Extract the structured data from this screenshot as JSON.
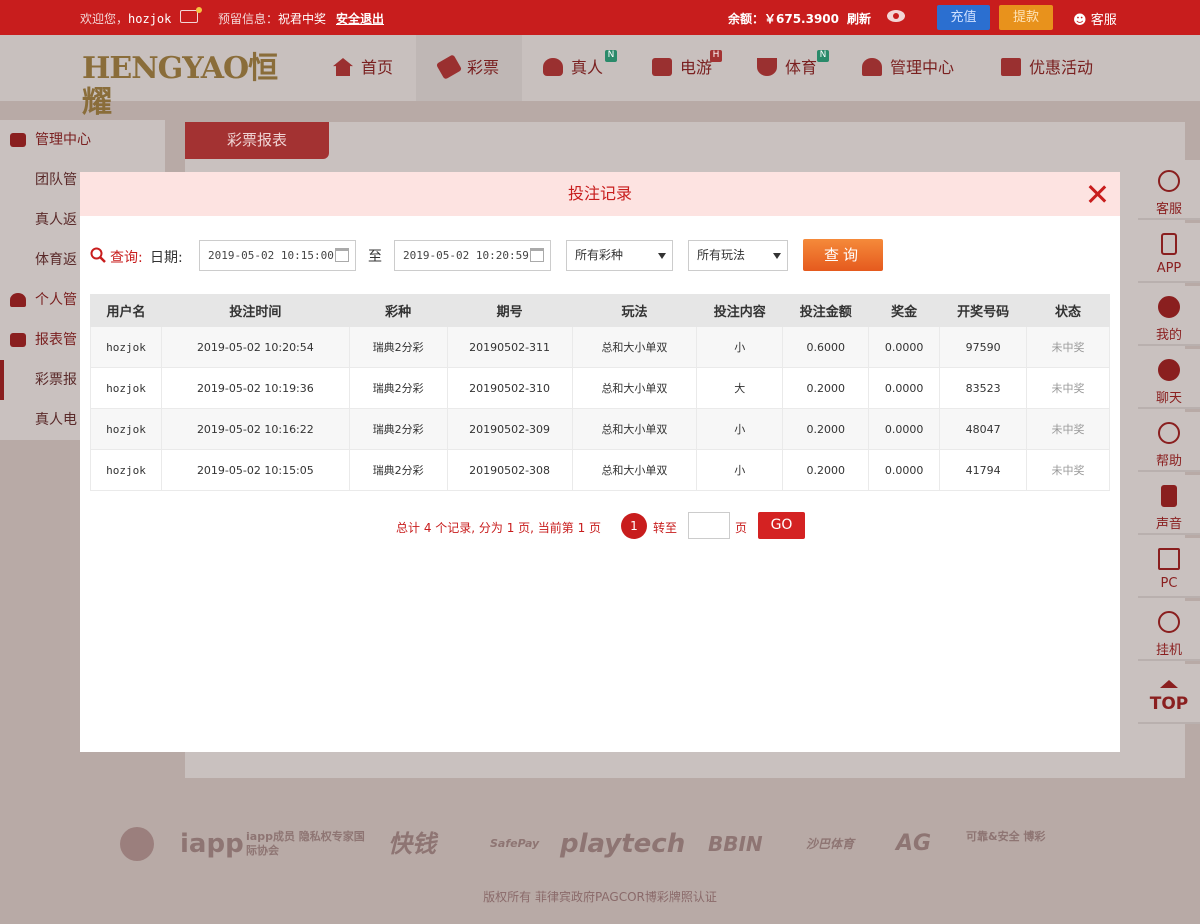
{
  "topbar": {
    "welcome_prefix": "欢迎您，",
    "username": "hozjok",
    "notice_label": "预留信息：",
    "notice_text": "祝君中奖",
    "logout": "安全退出",
    "balance": "余额：￥675.3900",
    "refresh": "刷新",
    "recharge": "充值",
    "withdraw": "提款",
    "customer_service": "客服"
  },
  "nav": {
    "logo": "HENGYAO恒耀",
    "items": [
      {
        "label": "首页",
        "badge": ""
      },
      {
        "label": "彩票",
        "badge": ""
      },
      {
        "label": "真人",
        "badge": "N"
      },
      {
        "label": "电游",
        "badge": "H"
      },
      {
        "label": "体育",
        "badge": "N"
      },
      {
        "label": "管理中心",
        "badge": ""
      },
      {
        "label": "优惠活动",
        "badge": ""
      }
    ]
  },
  "sidebar": {
    "items": [
      "管理中心",
      "团队管",
      "真人返",
      "体育返",
      "个人管",
      "报表管",
      "彩票报",
      "真人电"
    ]
  },
  "content": {
    "tab": "彩票报表"
  },
  "right_bar": [
    "客服",
    "APP",
    "我的",
    "聊天",
    "帮助",
    "声音",
    "PC",
    "挂机",
    "TOP"
  ],
  "modal": {
    "title": "投注记录",
    "query_label": "查询:",
    "date_label": "日期:",
    "start_date": "2019-05-02 10:15:00",
    "to_label": "至",
    "end_date": "2019-05-02 10:20:59",
    "lottery_select": "所有彩种",
    "play_select": "所有玩法",
    "query_button": "查询"
  },
  "table": {
    "headers": [
      "用户名",
      "投注时间",
      "彩种",
      "期号",
      "玩法",
      "投注内容",
      "投注金额",
      "奖金",
      "开奖号码",
      "状态"
    ],
    "rows": [
      [
        "hozjok",
        "2019-05-02 10:20:54",
        "瑞典2分彩",
        "20190502-311",
        "总和大小单双",
        "小",
        "0.6000",
        "0.0000",
        "97590",
        "未中奖"
      ],
      [
        "hozjok",
        "2019-05-02 10:19:36",
        "瑞典2分彩",
        "20190502-310",
        "总和大小单双",
        "大",
        "0.2000",
        "0.0000",
        "83523",
        "未中奖"
      ],
      [
        "hozjok",
        "2019-05-02 10:16:22",
        "瑞典2分彩",
        "20190502-309",
        "总和大小单双",
        "小",
        "0.2000",
        "0.0000",
        "48047",
        "未中奖"
      ],
      [
        "hozjok",
        "2019-05-02 10:15:05",
        "瑞典2分彩",
        "20190502-308",
        "总和大小单双",
        "小",
        "0.2000",
        "0.0000",
        "41794",
        "未中奖"
      ]
    ]
  },
  "pager": {
    "summary": "总计 4 个记录, 分为 1 页, 当前第 1 页",
    "current": "1",
    "goto_label": "转至",
    "page_label": "页",
    "go": "GO"
  },
  "footer": {
    "logos": [
      "iapp",
      "iapp成员 隐私权专家国际协会",
      "快钱",
      "SafePay",
      "playtech",
      "BBIN",
      "沙巴体育",
      "AG",
      "可靠&安全 博彩"
    ],
    "copyright": "版权所有 菲律宾政府PAGCOR博彩牌照认证"
  },
  "colors": {
    "brand_red": "#c81d1d",
    "overlay": "#b8aaa6",
    "query_orange": "#f0762c"
  }
}
